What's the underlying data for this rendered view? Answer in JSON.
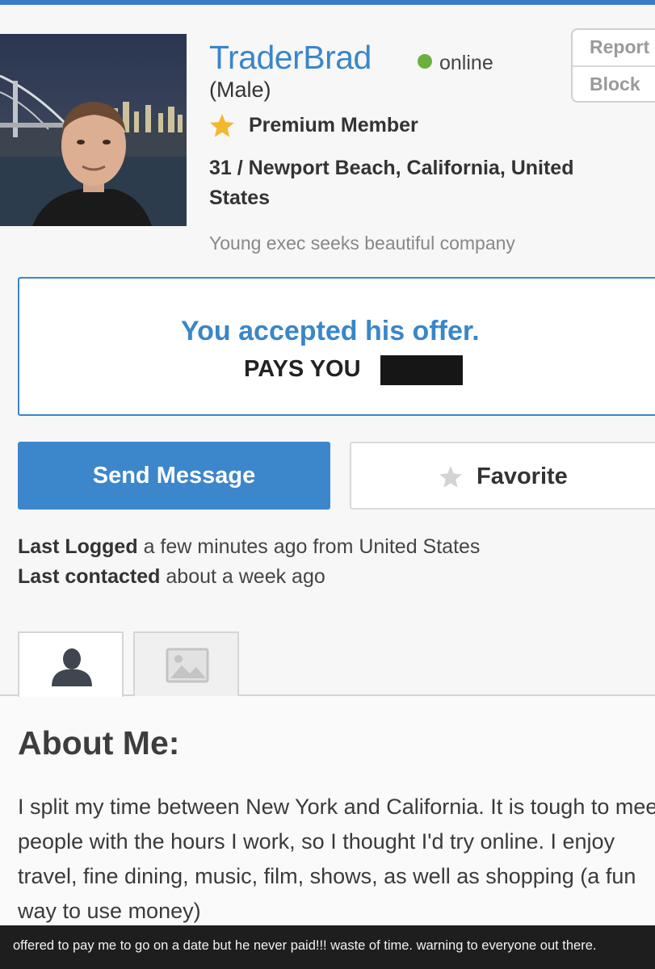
{
  "profile": {
    "username": "TraderBrad",
    "status": "online",
    "gender": "(Male)",
    "membership": "Premium Member",
    "location": "31 / Newport Beach, California, United States",
    "tagline": "Young exec seeks beautiful company"
  },
  "actions": {
    "report_label": "Report",
    "block_label": "Block"
  },
  "offer": {
    "title": "You accepted his offer.",
    "pays_label": "PAYS YOU"
  },
  "buttons": {
    "send_message": "Send Message",
    "favorite": "Favorite"
  },
  "activity": {
    "last_logged_label": "Last Logged",
    "last_logged_value": "a few minutes ago from United States",
    "last_contacted_label": "Last contacted",
    "last_contacted_value": "about a week ago"
  },
  "tabs": [
    {
      "icon": "user-silhouette-icon",
      "active": true
    },
    {
      "icon": "image-icon",
      "active": false
    }
  ],
  "about": {
    "heading": "About Me:",
    "text": "I split my time between New York and California. It is tough to meet people with the hours I work, so I thought I'd try online. I enjoy travel, fine dining, music, film, shows, as well as shopping (a fun way to use money)"
  },
  "caption": "offered to pay me to go on a date but he never paid!!! waste of time. warning to everyone out there.",
  "colors": {
    "accent": "#3a86c8",
    "online": "#6bb03c",
    "premium_star": "#f2b830"
  }
}
